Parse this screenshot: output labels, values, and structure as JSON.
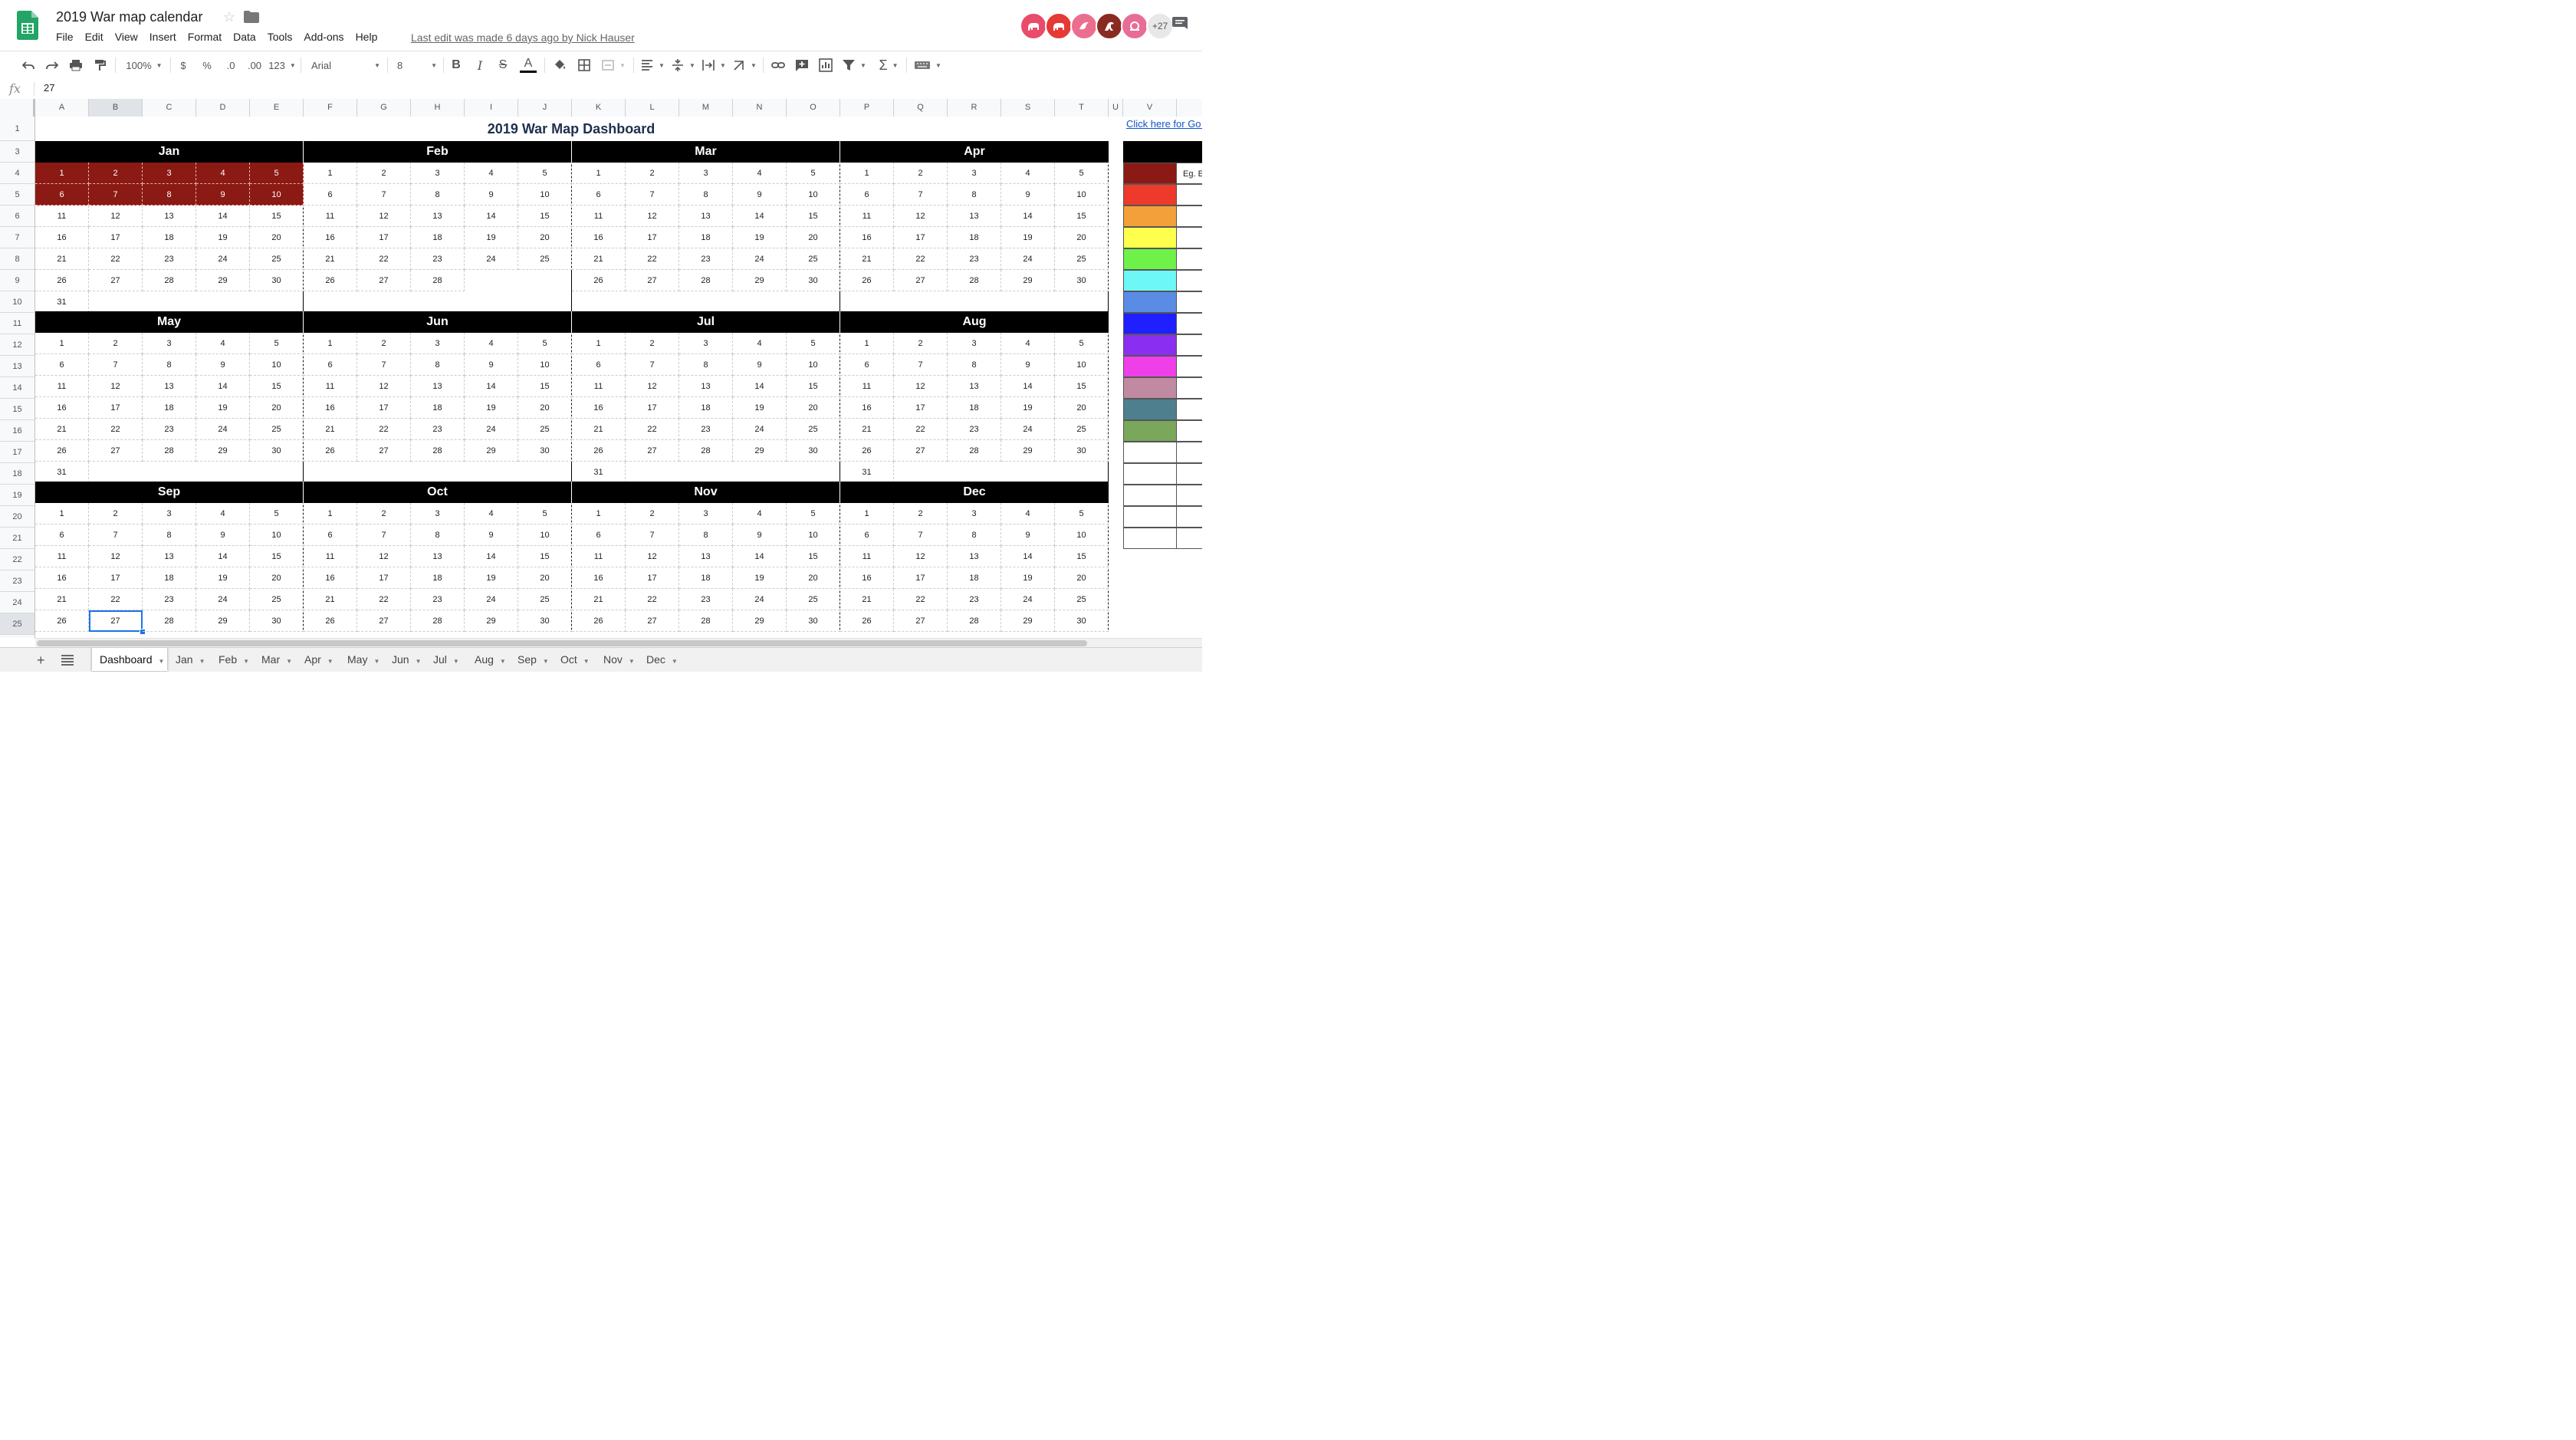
{
  "doc": {
    "title": "2019 War map calendar",
    "last_edit": "Last edit was made 6 days ago by Nick Hauser",
    "collaborators_more": "+27"
  },
  "menu": [
    "File",
    "Edit",
    "View",
    "Insert",
    "Format",
    "Data",
    "Tools",
    "Add-ons",
    "Help"
  ],
  "toolbar": {
    "zoom": "100%",
    "currency": "$",
    "percent": "%",
    "dec_less": ".0",
    "dec_more": ".00",
    "format_more": "123",
    "font": "Arial",
    "font_size": "8",
    "bold": "B",
    "italic": "I",
    "strike": "S",
    "text_color": "A",
    "sum": "Σ"
  },
  "formula_bar": {
    "fx": "fx",
    "value": "27"
  },
  "columns": [
    "A",
    "B",
    "C",
    "D",
    "E",
    "F",
    "G",
    "H",
    "I",
    "J",
    "K",
    "L",
    "M",
    "N",
    "O",
    "P",
    "Q",
    "R",
    "S",
    "T",
    "U",
    "V"
  ],
  "rows": [
    "1",
    "3",
    "4",
    "5",
    "6",
    "7",
    "8",
    "9",
    "10",
    "11",
    "12",
    "13",
    "14",
    "15",
    "16",
    "17",
    "18",
    "19",
    "20",
    "21",
    "22",
    "23",
    "24",
    "25"
  ],
  "dashboard": {
    "title": "2019 War Map Dashboard",
    "side_link": "Click here for Go 'Make a copy')",
    "legend_text": "Eg. E"
  },
  "months": [
    {
      "name": "Jan",
      "days": 31
    },
    {
      "name": "Feb",
      "days": 28
    },
    {
      "name": "Mar",
      "days": 30
    },
    {
      "name": "Apr",
      "days": 30
    },
    {
      "name": "May",
      "days": 31
    },
    {
      "name": "Jun",
      "days": 30
    },
    {
      "name": "Jul",
      "days": 31
    },
    {
      "name": "Aug",
      "days": 31
    },
    {
      "name": "Sep",
      "days": 30
    },
    {
      "name": "Oct",
      "days": 30
    },
    {
      "name": "Nov",
      "days": 30
    },
    {
      "name": "Dec",
      "days": 30
    }
  ],
  "highlighted_days": {
    "Jan": [
      1,
      2,
      3,
      4,
      5,
      6,
      7,
      8,
      9,
      10
    ]
  },
  "selected_cell": {
    "month": "Sep",
    "day": 27
  },
  "colors": {
    "highlight": "#8b1a14",
    "link": "#1155cc",
    "selection": "#1a73e8",
    "legend_swatches": [
      "#8b1a14",
      "#ee3a2b",
      "#f3a03a",
      "#ffff4d",
      "#6ef24a",
      "#6ef7f7",
      "#5a8ce6",
      "#1f1fff",
      "#8a2ff2",
      "#ef3fe9",
      "#c08aa3",
      "#4e7f8f",
      "#7aa75c",
      "#ffffff",
      "#ffffff",
      "#ffffff",
      "#ffffff",
      "#ffffff"
    ]
  },
  "tabs": [
    "Dashboard",
    "Jan",
    "Feb",
    "Mar",
    "Apr",
    "May",
    "Jun",
    "Jul",
    "Aug",
    "Sep",
    "Oct",
    "Nov",
    "Dec"
  ],
  "active_tab": "Dashboard"
}
